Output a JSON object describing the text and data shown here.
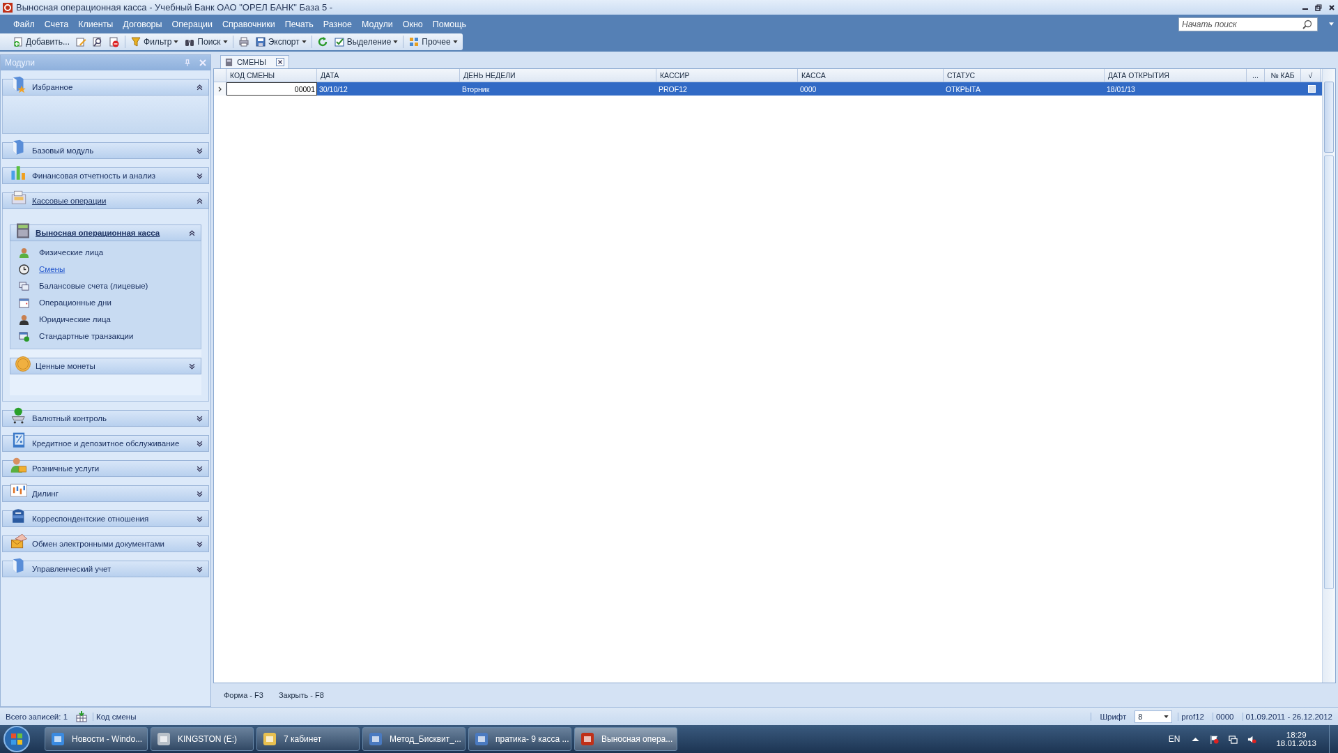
{
  "window": {
    "title": "Выносная операционная касса - Учебный Банк ОАО \"ОРЕЛ БАНК\" База 5 -"
  },
  "menu": [
    {
      "label": "Файл"
    },
    {
      "label": "Счета"
    },
    {
      "label": "Клиенты"
    },
    {
      "label": "Договоры"
    },
    {
      "label": "Операции"
    },
    {
      "label": "Справочники"
    },
    {
      "label": "Печать"
    },
    {
      "label": "Разное"
    },
    {
      "label": "Модули"
    },
    {
      "label": "Окно"
    },
    {
      "label": "Помощь"
    }
  ],
  "search": {
    "placeholder": "Начать поиск"
  },
  "toolbar": [
    {
      "kind": "labeled",
      "label": "Добавить...",
      "dropdown": false
    },
    {
      "kind": "icon"
    },
    {
      "kind": "icon"
    },
    {
      "kind": "icon"
    },
    {
      "kind": "separator"
    },
    {
      "kind": "labeled",
      "label": "Фильтр",
      "dropdown": true
    },
    {
      "kind": "labeled",
      "label": "Поиск",
      "dropdown": true
    },
    {
      "kind": "separator"
    },
    {
      "kind": "icon"
    },
    {
      "kind": "labeled",
      "label": "Экспорт",
      "dropdown": true
    },
    {
      "kind": "separator"
    },
    {
      "kind": "icon"
    },
    {
      "kind": "labeled",
      "label": "Выделение",
      "dropdown": true
    },
    {
      "kind": "separator"
    },
    {
      "kind": "labeled",
      "label": "Прочее",
      "dropdown": true
    }
  ],
  "sidebar": {
    "title": "Модули",
    "groups": [
      {
        "label": "Избранное",
        "expanded": true,
        "active": false
      },
      {
        "label": "Базовый модуль",
        "expanded": false,
        "active": false
      },
      {
        "label": "Финансовая отчетность и анализ",
        "expanded": false,
        "active": false
      },
      {
        "label": "Кассовые операции",
        "expanded": true,
        "active": true,
        "children": [
          {
            "label": "Выносная операционная касса",
            "expanded": true,
            "active": true,
            "items": [
              {
                "label": "Физические лица",
                "selected": false
              },
              {
                "label": "Смены",
                "selected": true
              },
              {
                "label": "Балансовые счета (лицевые)",
                "selected": false
              },
              {
                "label": "Операционные дни",
                "selected": false
              },
              {
                "label": "Юридические лица",
                "selected": false
              },
              {
                "label": "Стандартные транзакции",
                "selected": false
              }
            ]
          },
          {
            "label": "Ценные монеты",
            "expanded": false,
            "active": false
          }
        ]
      },
      {
        "label": "Валютный контроль",
        "expanded": false,
        "active": false
      },
      {
        "label": "Кредитное и депозитное обслуживание",
        "expanded": false,
        "active": false
      },
      {
        "label": "Розничные услуги",
        "expanded": false,
        "active": false
      },
      {
        "label": "Дилинг",
        "expanded": false,
        "active": false
      },
      {
        "label": "Корреспондентские отношения",
        "expanded": false,
        "active": false
      },
      {
        "label": "Обмен электронными документами",
        "expanded": false,
        "active": false
      },
      {
        "label": "Управленческий учет",
        "expanded": false,
        "active": false
      }
    ]
  },
  "document_tab": {
    "label": "СМЕНЫ"
  },
  "table": {
    "columns": [
      "КОД СМЕНЫ",
      "ДАТА",
      "ДЕНЬ НЕДЕЛИ",
      "КАССИР",
      "КАССА",
      "СТАТУС",
      "ДАТА ОТКРЫТИЯ",
      "...",
      "№ КАБ",
      "√"
    ],
    "rows": [
      {
        "cells": [
          "00001",
          "30/10/12",
          "Вторник",
          "PROF12",
          "0000",
          "ОТКРЫТА",
          "18/01/13"
        ],
        "selected": true,
        "checked": false
      }
    ]
  },
  "hotkeys": [
    "Форма - F3",
    "Закрыть - F8"
  ],
  "status_bar": {
    "records": "Всего записей: 1",
    "field": "Код смены",
    "font_label": "Шрифт",
    "font_value": "8",
    "user": "prof12",
    "cash_desk": "0000",
    "period": "01.09.2011 - 26.12.2012"
  },
  "taskbar": {
    "tasks": [
      {
        "label": "Новости - Windo...",
        "selected": false
      },
      {
        "label": "KINGSTON (E:)",
        "selected": false
      },
      {
        "label": "7 кабинет",
        "selected": false
      },
      {
        "label": "Метод_Бисквит_...",
        "selected": false
      },
      {
        "label": "пратика- 9 касса ...",
        "selected": false
      },
      {
        "label": "Выносная опера...",
        "selected": true
      }
    ],
    "language": "EN",
    "time": "18:29",
    "date": "18.01.2013"
  }
}
